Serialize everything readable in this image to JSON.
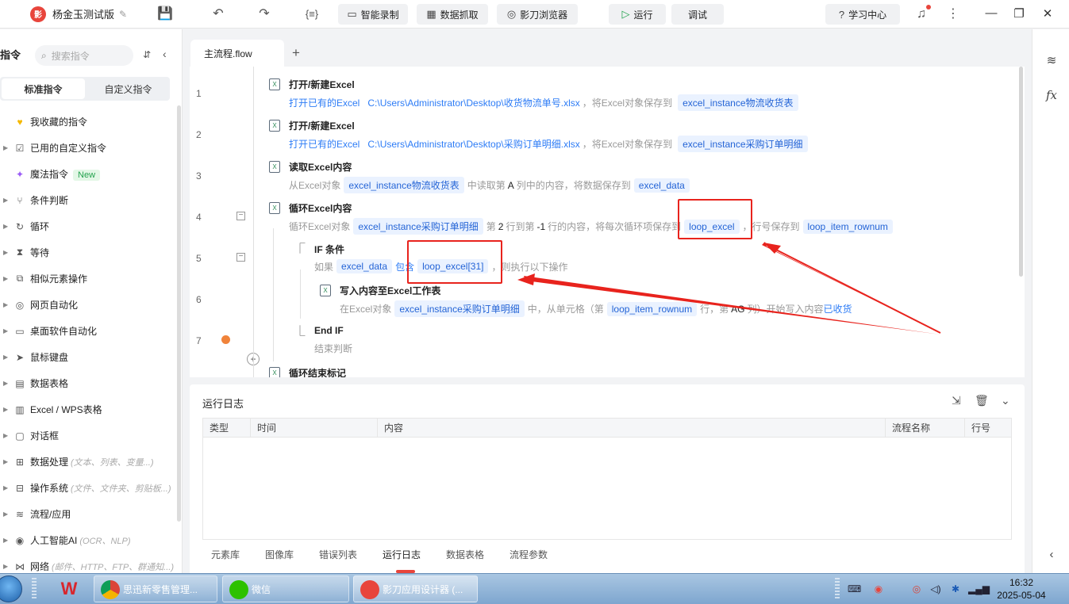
{
  "app": {
    "name": "杨金玉测试版",
    "logo_text": "影"
  },
  "toolbar": {
    "code_icon": "{≡}",
    "smart_record": "智能录制",
    "data_capture": "数据抓取",
    "browser": "影刀浏览器",
    "run": "运行",
    "debug": "调试",
    "learn": "学习中心"
  },
  "left": {
    "header": "指令",
    "search_placeholder": "搜索指令",
    "tabs": [
      "标准指令",
      "自定义指令"
    ],
    "items": [
      {
        "label": "我收藏的指令",
        "hint": ""
      },
      {
        "label": "已用的自定义指令",
        "hint": ""
      },
      {
        "label": "魔法指令",
        "hint": "",
        "badge": "New"
      },
      {
        "label": "条件判断",
        "hint": ""
      },
      {
        "label": "循环",
        "hint": ""
      },
      {
        "label": "等待",
        "hint": ""
      },
      {
        "label": "相似元素操作",
        "hint": ""
      },
      {
        "label": "网页自动化",
        "hint": ""
      },
      {
        "label": "桌面软件自动化",
        "hint": ""
      },
      {
        "label": "鼠标键盘",
        "hint": ""
      },
      {
        "label": "数据表格",
        "hint": ""
      },
      {
        "label": "Excel / WPS表格",
        "hint": ""
      },
      {
        "label": "对话框",
        "hint": ""
      },
      {
        "label": "数据处理",
        "hint": "(文本、列表、变量...)"
      },
      {
        "label": "操作系统",
        "hint": "(文件、文件夹、剪贴板...)"
      },
      {
        "label": "流程/应用",
        "hint": ""
      },
      {
        "label": "人工智能AI",
        "hint": "(OCR、NLP)"
      },
      {
        "label": "网络",
        "hint": "(邮件、HTTP、FTP、群通知...)"
      }
    ]
  },
  "editor": {
    "tab": "主流程.flow",
    "line_numbers": [
      "1",
      "2",
      "3",
      "4",
      "5",
      "6",
      "7"
    ],
    "steps": [
      {
        "title": "打开/新建Excel",
        "p1": "打开已有的Excel",
        "path": "C:\\Users\\Administrator\\Desktop\\收货物流单号.xlsx",
        "p2": "，将Excel对象保存到",
        "var": "excel_instance物流收货表"
      },
      {
        "title": "打开/新建Excel",
        "p1": "打开已有的Excel",
        "path": "C:\\Users\\Administrator\\Desktop\\采购订单明细.xlsx",
        "p2": "，将Excel对象保存到",
        "var": "excel_instance采购订单明细"
      },
      {
        "title": "读取Excel内容",
        "p1": "从Excel对象",
        "var1": "excel_instance物流收货表",
        "p2": "中读取第",
        "col": "A",
        "p3": "列中的内容，将数据保存到",
        "var2": "excel_data"
      },
      {
        "title": "循环Excel内容",
        "p1": "循环Excel对象",
        "var1": "excel_instance采购订单明细",
        "p2": "第",
        "n1": "2",
        "p3": "行到第",
        "n2": "-1",
        "p4": "行的内容，将每次循环项保存到",
        "var2": "loop_excel",
        "p5": "，行号保存到",
        "var3": "loop_item_rownum"
      },
      {
        "title": "IF 条件",
        "p1": "如果",
        "var1": "excel_data",
        "op": "包含",
        "var2": "loop_excel[31]",
        "p2": "，则执行以下操作"
      },
      {
        "title": "写入内容至Excel工作表",
        "p1": "在Excel对象",
        "var1": "excel_instance采购订单明细",
        "p2": "中，从单元格（第",
        "var2": "loop_item_rownum",
        "p3": "行，第",
        "col": "AG",
        "p4": "列）开始写入内容",
        "val": "已收货"
      },
      {
        "title": "End IF",
        "p1": "结束判断"
      },
      {
        "title": "循环结束标记"
      }
    ]
  },
  "log": {
    "title": "运行日志",
    "columns": [
      "类型",
      "时间",
      "内容",
      "流程名称",
      "行号"
    ],
    "tabs": [
      "元素库",
      "图像库",
      "错误列表",
      "运行日志",
      "数据表格",
      "流程参数"
    ]
  },
  "taskbar": {
    "apps": [
      "思迅新零售管理...",
      "微信",
      "影刀应用设计器 (..."
    ],
    "time": "16:32",
    "date": "2025-05-04"
  },
  "colors": {
    "accent": "#2d7cf6",
    "tag_bg": "#eaf2ff",
    "annotation": "#e8231d",
    "breakpoint": "#f0833a"
  }
}
